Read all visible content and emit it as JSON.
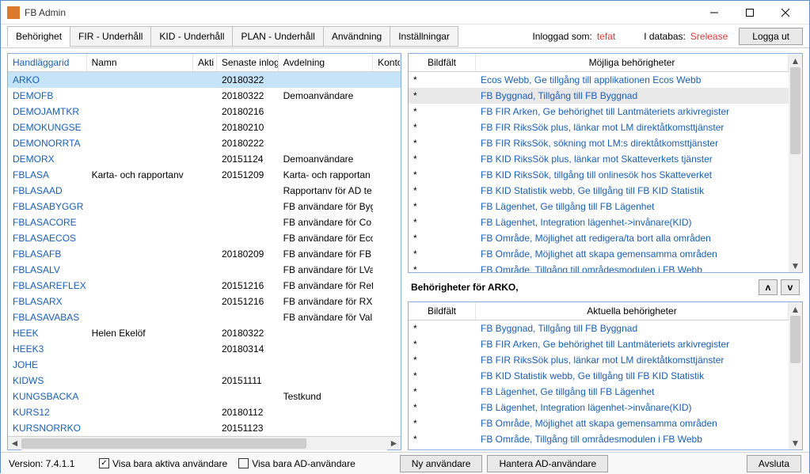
{
  "window": {
    "title": "FB Admin"
  },
  "tabs": [
    "Behörighet",
    "FIR - Underhåll",
    "KID - Underhåll",
    "PLAN - Underhåll",
    "Användning",
    "Inställningar"
  ],
  "active_tab": 0,
  "login": {
    "label_in": "Inloggad som:",
    "user": "tefat",
    "label_db": "I databas:",
    "db": "Srelease"
  },
  "logout_label": "Logga ut",
  "users_table": {
    "headers": {
      "id": "Handläggarid",
      "name": "Namn",
      "akt": "Akti",
      "date": "Senaste inlogg",
      "avd": "Avdelning",
      "kont": "Konto"
    },
    "rows": [
      {
        "id": "ARKO",
        "name": "",
        "date": "20180322",
        "avd": "",
        "selected": true
      },
      {
        "id": "DEMOFB",
        "name": "",
        "date": "20180322",
        "avd": "Demoanvändare"
      },
      {
        "id": "DEMOJAMTKR",
        "name": "",
        "date": "20180216",
        "avd": ""
      },
      {
        "id": "DEMOKUNGSE",
        "name": "",
        "date": "20180210",
        "avd": ""
      },
      {
        "id": "DEMONORRTA",
        "name": "",
        "date": "20180222",
        "avd": ""
      },
      {
        "id": "DEMORX",
        "name": "",
        "date": "20151124",
        "avd": "Demoanvändare"
      },
      {
        "id": "FBLASA",
        "name": "Karta- och rapportanv",
        "date": "20151209",
        "avd": "Karta- och rapportan"
      },
      {
        "id": "FBLASAAD",
        "name": "",
        "date": "",
        "avd": "Rapportanv för AD te"
      },
      {
        "id": "FBLASABYGGR",
        "name": "",
        "date": "",
        "avd": "FB användare för Byg"
      },
      {
        "id": "FBLASACORE",
        "name": "",
        "date": "",
        "avd": "FB användare för Co"
      },
      {
        "id": "FBLASAECOS",
        "name": "",
        "date": "",
        "avd": "FB användare för Eco"
      },
      {
        "id": "FBLASAFB",
        "name": "",
        "date": "20180209",
        "avd": "FB användare för FB"
      },
      {
        "id": "FBLASALV",
        "name": "",
        "date": "",
        "avd": "FB användare för LVa"
      },
      {
        "id": "FBLASAREFLEX",
        "name": "",
        "date": "20151216",
        "avd": "FB användare för Ref"
      },
      {
        "id": "FBLASARX",
        "name": "",
        "date": "20151216",
        "avd": "FB användare för RX"
      },
      {
        "id": "FBLASAVABAS",
        "name": "",
        "date": "",
        "avd": "FB användare för Val"
      },
      {
        "id": "HEEK",
        "name": "Helen Ekelöf",
        "date": "20180322",
        "avd": ""
      },
      {
        "id": "HEEK3",
        "name": "",
        "date": "20180314",
        "avd": ""
      },
      {
        "id": "JOHE",
        "name": "",
        "date": "",
        "avd": ""
      },
      {
        "id": "KIDWS",
        "name": "",
        "date": "20151111",
        "avd": ""
      },
      {
        "id": "KUNGSBACKA",
        "name": "",
        "date": "",
        "avd": "Testkund"
      },
      {
        "id": "KURS12",
        "name": "",
        "date": "20180112",
        "avd": ""
      },
      {
        "id": "KURSNORRKO",
        "name": "",
        "date": "20151123",
        "avd": ""
      }
    ]
  },
  "possible_perms": {
    "head_bild": "Bildfält",
    "head_perm": "Möjliga behörigheter",
    "rows": [
      {
        "b": "*",
        "p": "Ecos Webb, Ge tillgång till applikationen Ecos Webb"
      },
      {
        "b": "*",
        "p": "FB Byggnad, Tillgång till FB Byggnad",
        "selected": true
      },
      {
        "b": "*",
        "p": "FB FIR Arken, Ge behörighet till Lantmäteriets arkivregister"
      },
      {
        "b": "*",
        "p": "FB FIR RiksSök plus, länkar mot LM direktåtkomsttjänster"
      },
      {
        "b": "*",
        "p": "FB FIR RiksSök, sökning mot LM:s direktåtkomsttjänster"
      },
      {
        "b": "*",
        "p": "FB KID RiksSök plus, länkar mot Skatteverkets tjänster"
      },
      {
        "b": "*",
        "p": "FB KID RiksSök, tillgång till onlinesök hos Skatteverket"
      },
      {
        "b": "*",
        "p": "FB KID Statistik webb, Ge tillgång till FB KID Statistik"
      },
      {
        "b": "*",
        "p": "FB Lägenhet, Ge tillgång till FB Lägenhet"
      },
      {
        "b": "*",
        "p": "FB Lägenhet, Integration lägenhet->invånare(KID)"
      },
      {
        "b": "*",
        "p": "FB Område, Möjlighet att redigera/ta bort alla områden"
      },
      {
        "b": "*",
        "p": "FB Område, Möjlighet att skapa gemensamma områden"
      },
      {
        "b": "*",
        "p": "FB Område, Tillgång till områdesmodulen i FB Webb"
      }
    ]
  },
  "mid": {
    "label": "Behörigheter för ARKO,",
    "up": "ʌ",
    "down": "v"
  },
  "current_perms": {
    "head_bild": "Bildfält",
    "head_perm": "Aktuella behörigheter",
    "rows": [
      {
        "b": "*",
        "p": "FB Byggnad, Tillgång till FB Byggnad"
      },
      {
        "b": "*",
        "p": "FB FIR Arken, Ge behörighet till Lantmäteriets arkivregister"
      },
      {
        "b": "*",
        "p": "FB FIR RiksSök plus, länkar mot LM direktåtkomsttjänster"
      },
      {
        "b": "*",
        "p": "FB KID Statistik webb, Ge tillgång till FB KID Statistik"
      },
      {
        "b": "*",
        "p": "FB Lägenhet, Ge tillgång till FB Lägenhet"
      },
      {
        "b": "*",
        "p": "FB Lägenhet, Integration lägenhet->invånare(KID)"
      },
      {
        "b": "*",
        "p": "FB Område, Möjlighet att skapa gemensamma områden"
      },
      {
        "b": "*",
        "p": "FB Område, Tillgång till områdesmodulen i FB Webb"
      }
    ]
  },
  "footer": {
    "version": "Version: 7.4.1.1",
    "chk1": "Visa bara aktiva användare",
    "chk2": "Visa bara AD-användare",
    "btn_new": "Ny användare",
    "btn_ad": "Hantera AD-användare",
    "btn_close": "Avsluta"
  }
}
